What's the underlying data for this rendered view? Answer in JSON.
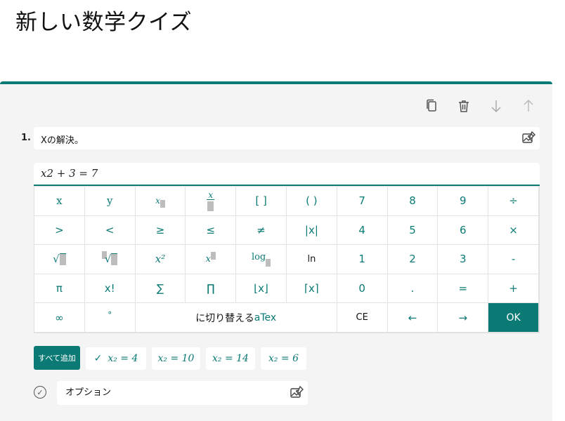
{
  "page": {
    "title": "新しい数学クイズ"
  },
  "toolbar": {
    "icons": [
      "copy-icon",
      "trash-icon",
      "arrow-down-icon",
      "arrow-up-icon"
    ]
  },
  "question": {
    "number": "1.",
    "text": "Xの解決。",
    "equation": "x2 + 3 = 7"
  },
  "keypad": {
    "row1": [
      "x",
      "y",
      "",
      "",
      "[ ]",
      "( )",
      "7",
      "8",
      "9",
      "÷"
    ],
    "row2": [
      ">",
      "<",
      "≥",
      "≤",
      "≠",
      "|x|",
      "4",
      "5",
      "6",
      "×"
    ],
    "row3": [
      "√",
      "√",
      "x²",
      "x",
      "log",
      "ln",
      "1",
      "2",
      "3",
      "-"
    ],
    "row4": [
      "π",
      "x!",
      "∑",
      "∏",
      "⌊x⌋",
      "⌈x⌉",
      "0",
      ".",
      "=",
      "+"
    ],
    "row5": {
      "infinity": "∞",
      "degree": "°",
      "latex_prefix": "に切り替える",
      "latex_suffix": "aTex",
      "ce": "CE",
      "left": "←",
      "right": "→",
      "ok": "OK"
    },
    "sub_x": "x",
    "frac_x": "x",
    "sup_2": "2"
  },
  "answers": {
    "add_all_label": "すべて追加",
    "chips": [
      {
        "label": "x₂ = 4",
        "checked": true
      },
      {
        "label": "x₂ = 10",
        "checked": false
      },
      {
        "label": "x₂ = 14",
        "checked": false
      },
      {
        "label": "x₂ = 6",
        "checked": false
      }
    ]
  },
  "option": {
    "text": "オプション"
  },
  "colors": {
    "accent": "#0b7a75",
    "card": "#f4f4f4"
  }
}
